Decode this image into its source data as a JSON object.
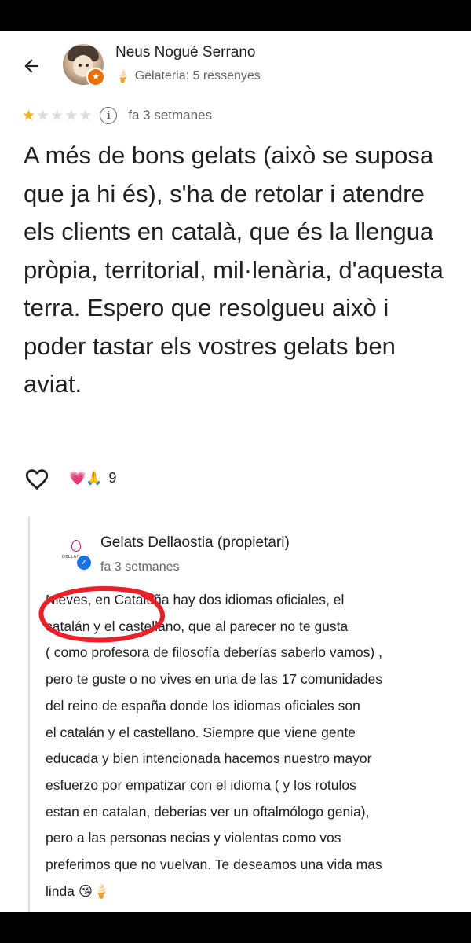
{
  "review": {
    "reviewer_name": "Neus Nogué Serrano",
    "reviewer_meta": "Gelateria: 5 ressenyes",
    "rating": 1,
    "max_rating": 5,
    "date": "fa 3 setmanes",
    "text": "A més de bons gelats (això se suposa que ja hi és), s'ha de retolar i atendre els clients en català, que és la llengua pròpia, territorial, mil·lenària, d'aquesta terra. Espero que resolgueu això i poder tastar els vostres gelats ben aviat.",
    "reactions_emoji": "💗🙏",
    "reactions_count": "9"
  },
  "owner_reply": {
    "logo_text": "DELLAOSTIA",
    "name": "Gelats Dellaostia (propietari)",
    "date": "fa 3 setmanes",
    "text": "Nieves, en Cataluña hay dos idiomas oficiales, el\ncatalán y el castellano, que al parecer no te gusta\n( como profesora de filosofía deberías saberlo vamos) ,\npero te guste o no vives en una de las 17 comunidades\ndel reino de españa donde los idiomas oficiales son\nel catalán y el castellano.  Siempre que viene gente\neducada y bien intencionada hacemos nuestro mayor\nesfuerzo por empatizar con el idioma ( y los rotulos\nestan en catalan, deberias ver un oftalmólogo genia),\npero a las personas necias y violentas  como vos\npreferimos que no vuelvan. Te deseamos una vida mas\nlinda 😘🍦"
  },
  "colors": {
    "star_filled": "#f2b01e",
    "star_empty": "#dadce0",
    "annotation_circle": "#e8202a",
    "verified": "#1a73e8",
    "local_guide": "#e8710a"
  }
}
